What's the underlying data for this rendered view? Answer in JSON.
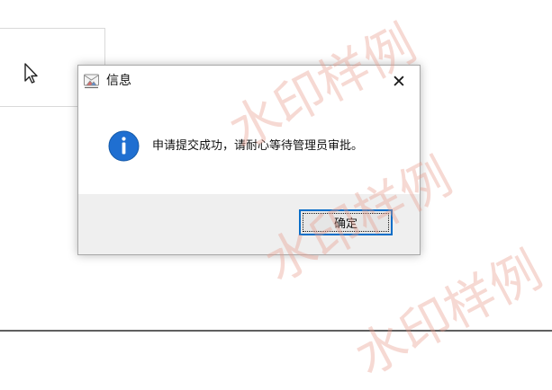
{
  "dialog": {
    "title": "信息",
    "close_symbol": "✕",
    "message": "申请提交成功，请耐心等待管理员审批。",
    "ok_label": "确定"
  },
  "watermark": {
    "text": "水印样例"
  },
  "icons": {
    "app": "app-icon",
    "info": "info-icon",
    "close": "close-icon",
    "cursor": "cursor-icon"
  },
  "colors": {
    "accent": "#0a6ec8",
    "info_icon": "#1f6fd1",
    "footer_bg": "#efefef",
    "watermark": "#e89c8c"
  }
}
